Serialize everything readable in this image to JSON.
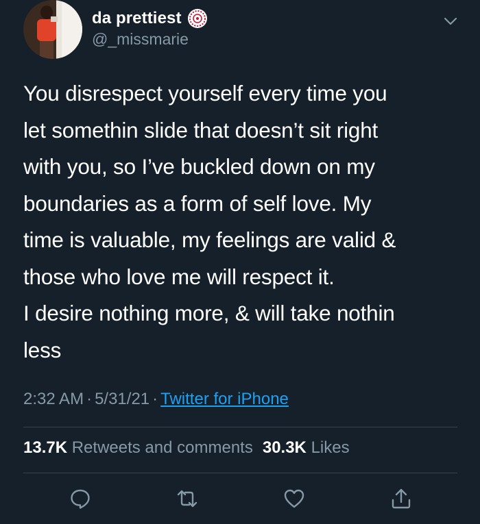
{
  "user": {
    "display_name": "da prettiest",
    "handle": "@_missmarie",
    "name_emoji": "sparkle-badge-emoji"
  },
  "tweet": {
    "text": "You disrespect yourself every time you\nlet somethin slide that doesn’t sit right\nwith you, so I’ve buckled down on my\nboundaries as a form of self love. My\ntime is valuable, my feelings are valid &\nthose who love me will respect it.\nI desire nothing more, & will take nothin\nless",
    "time": "2:32 AM",
    "date": "5/31/21",
    "separator": "·",
    "source": "Twitter for iPhone"
  },
  "stats": {
    "retweets_count": "13.7K",
    "retweets_label": "Retweets and comments",
    "likes_count": "30.3K",
    "likes_label": "Likes"
  },
  "icons": {
    "more": "chevron-down-icon",
    "reply": "reply-icon",
    "retweet": "retweet-icon",
    "like": "heart-icon",
    "share": "share-icon"
  },
  "colors": {
    "background": "#15202b",
    "text": "#ffffff",
    "secondary_text": "#8899a6",
    "link": "#1da1f2",
    "divider": "#38444d"
  }
}
